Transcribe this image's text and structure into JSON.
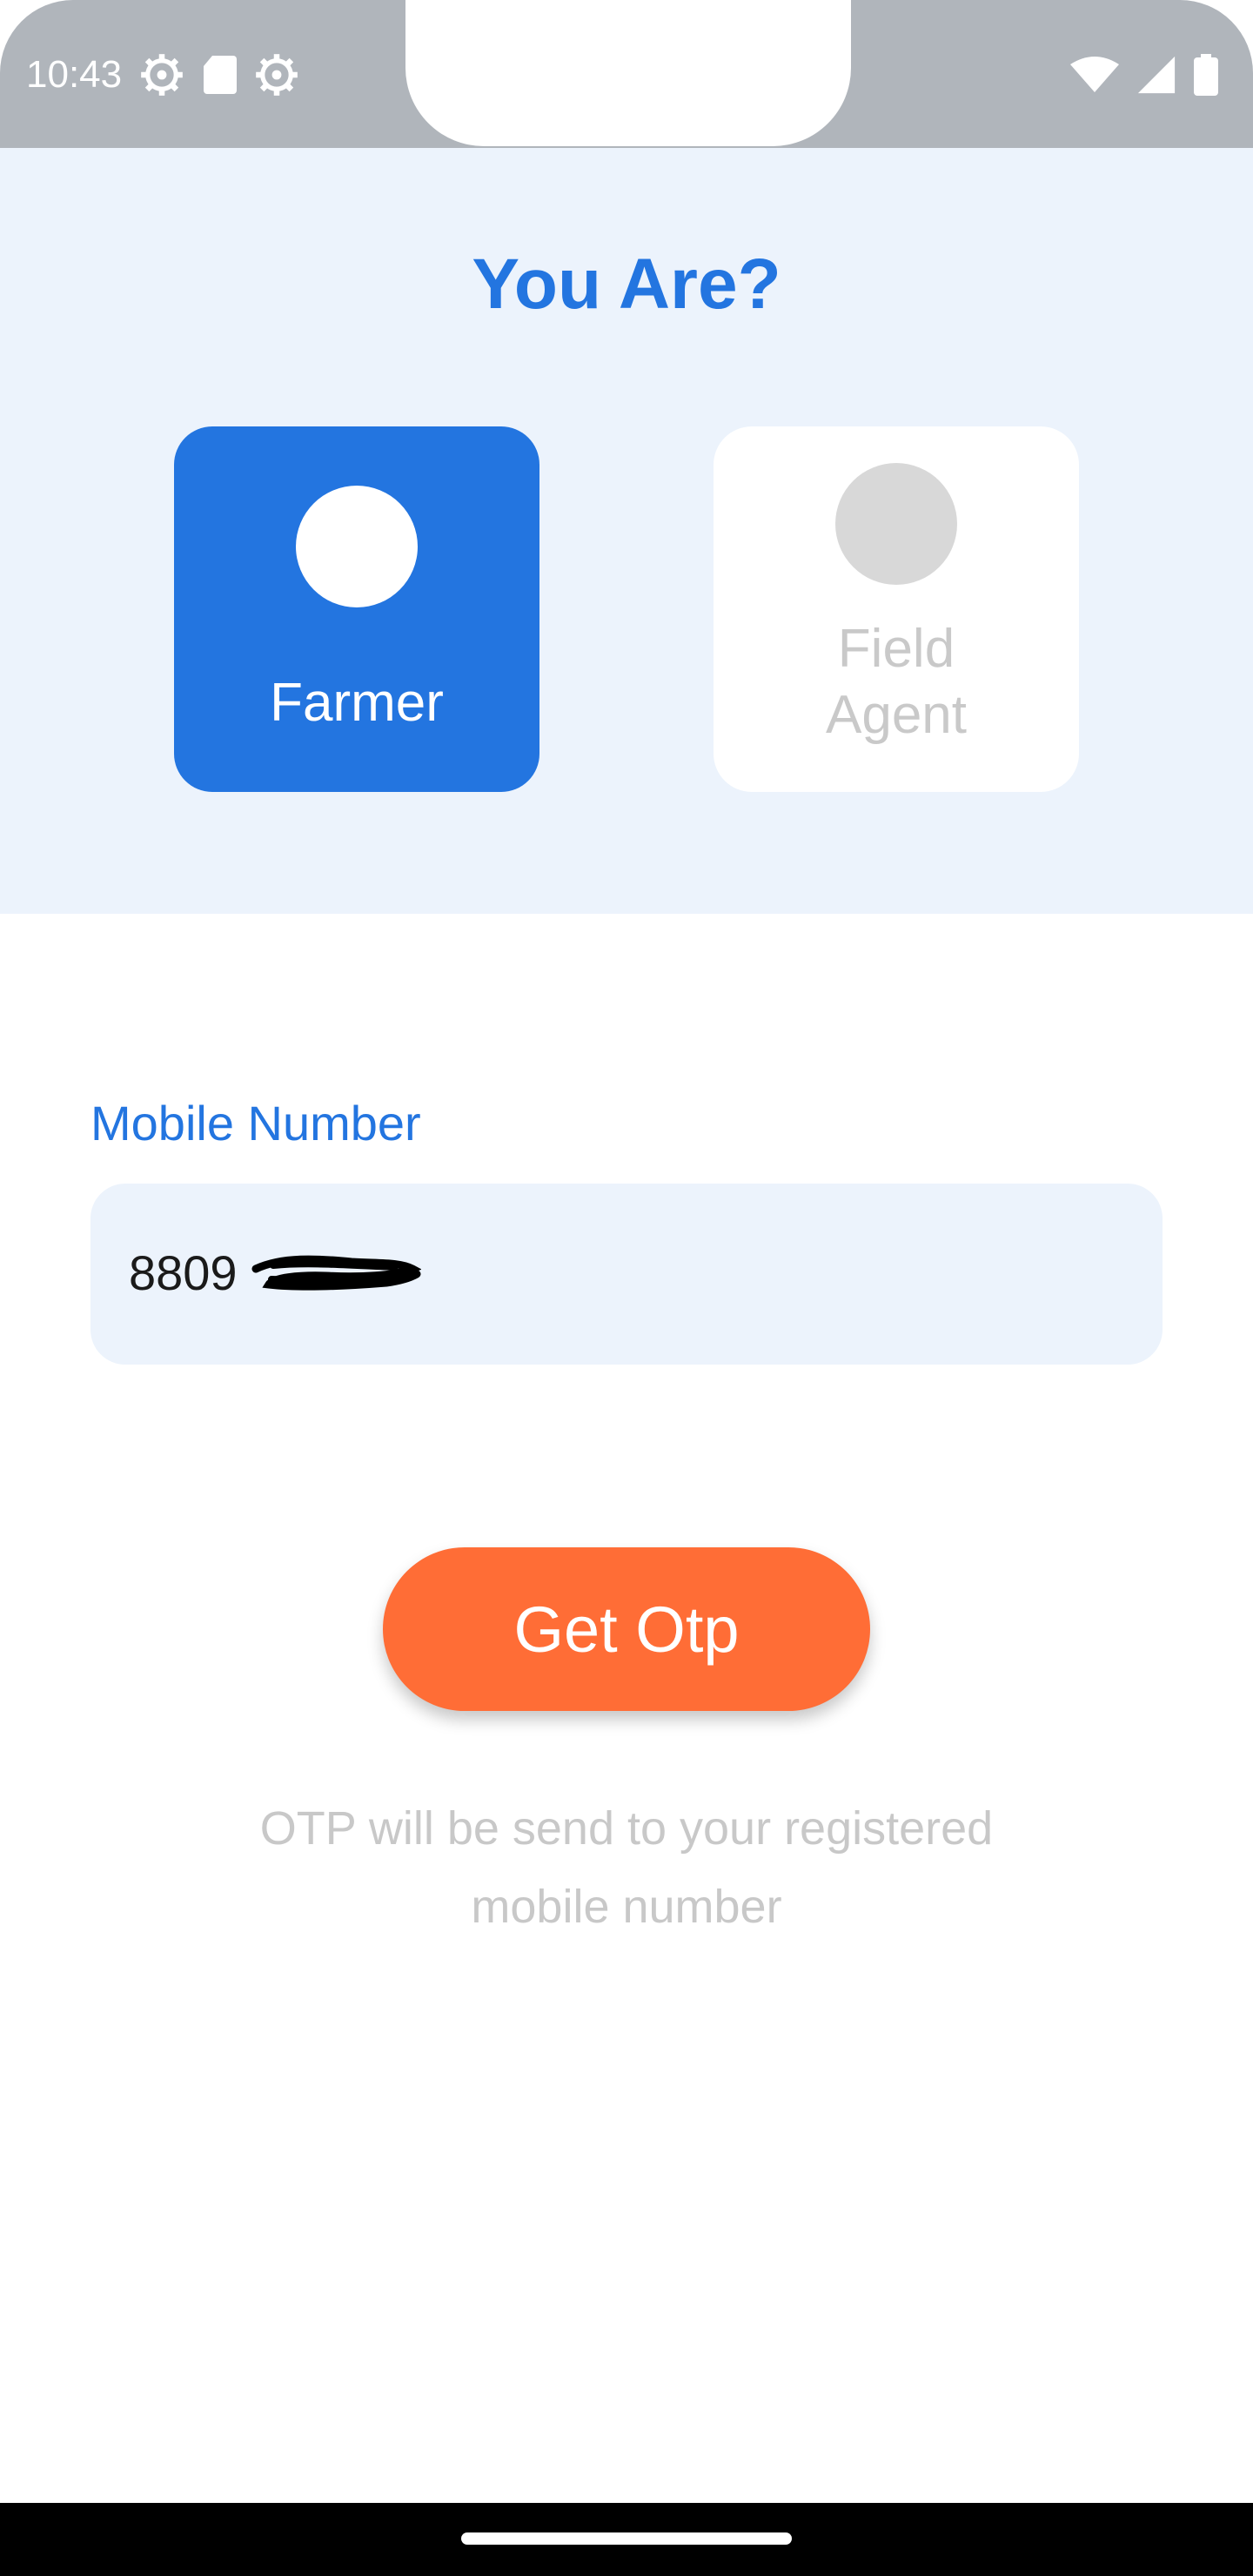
{
  "status_bar": {
    "time": "10:43",
    "left_icons": [
      "settings-gear-icon",
      "sd-card-icon",
      "settings-gear-icon"
    ],
    "right_icons": [
      "wifi-icon",
      "cellular-signal-icon",
      "battery-icon"
    ]
  },
  "role_selection": {
    "title": "You Are?",
    "options": [
      {
        "label": "Farmer",
        "selected": true
      },
      {
        "label_line1": "Field",
        "label_line2": "Agent",
        "selected": false
      }
    ]
  },
  "form": {
    "mobile_label": "Mobile Number",
    "mobile_value": "8809"
  },
  "actions": {
    "get_otp_label": "Get Otp"
  },
  "hint": {
    "line1": "OTP will be send to your registered",
    "line2": "mobile number"
  },
  "colors": {
    "primary": "#2375e0",
    "accent": "#ff6d36",
    "panel_bg": "#ecf3fc"
  }
}
